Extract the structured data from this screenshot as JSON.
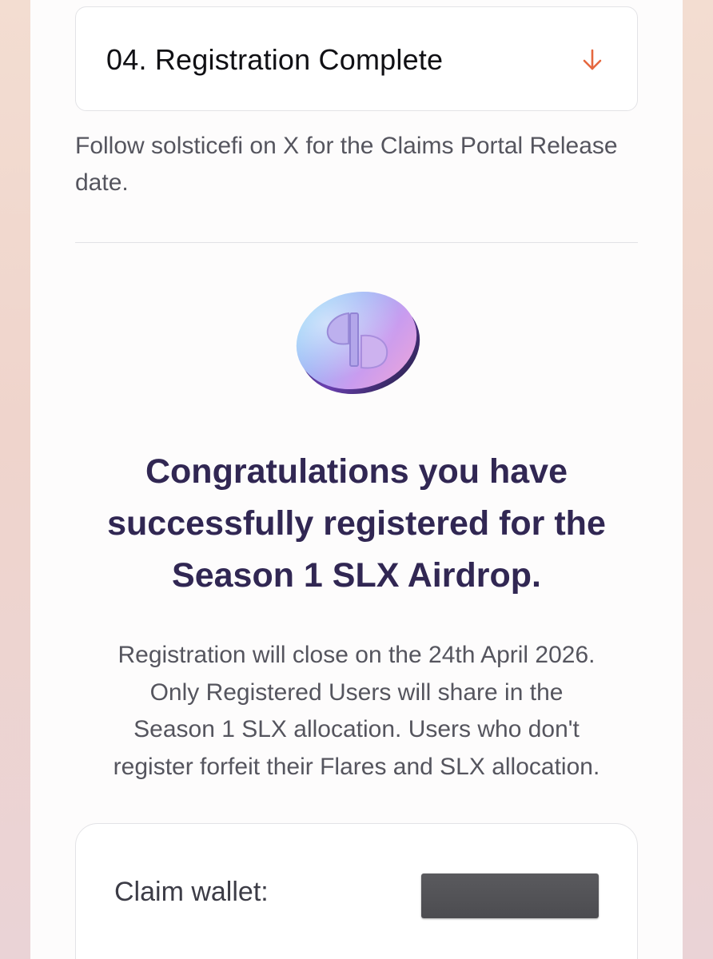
{
  "step": {
    "number": "04.",
    "title": "Registration Complete",
    "toggle_icon": "arrow-down-icon"
  },
  "follow_text": "Follow solsticefi on X for the Claims Portal Release date.",
  "logo_icon": "solstice-coin-logo",
  "congrats": {
    "lines": [
      "Congratulations you have",
      "successfully registered for the",
      "Season 1 SLX Airdrop."
    ]
  },
  "registration_info": {
    "lines": [
      "Registration will close on the 24th April 2026.",
      "Only Registered Users will share in the",
      "Season 1 SLX allocation. Users who don't",
      "register forfeit their Flares and SLX allocation."
    ]
  },
  "wallet": {
    "label": "Claim wallet:",
    "value_redacted": true
  },
  "colors": {
    "accent_arrow": "#e5683f",
    "heading": "#312753",
    "body_text": "#55555e",
    "page_background": "#f3ddd1",
    "panel_background": "#fdfcfc"
  }
}
